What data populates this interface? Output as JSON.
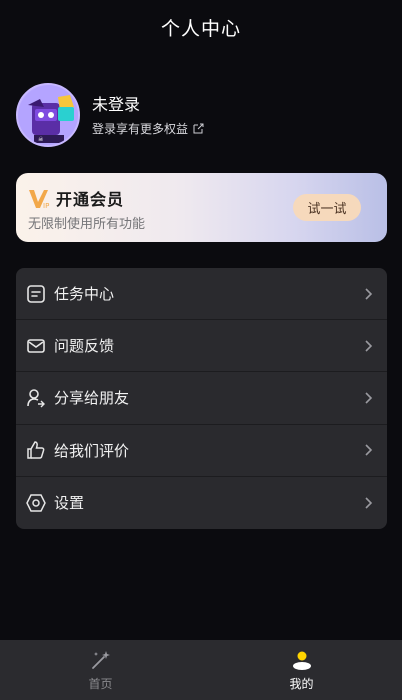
{
  "header": {
    "title": "个人中心"
  },
  "profile": {
    "name": "未登录",
    "subtitle": "登录享有更多权益"
  },
  "vip": {
    "title": "开通会员",
    "subtitle": "无限制使用所有功能",
    "button": "试一试",
    "logo_text": "VIP"
  },
  "menu": {
    "items": [
      {
        "label": "任务中心",
        "icon": "task-icon"
      },
      {
        "label": "问题反馈",
        "icon": "mail-icon"
      },
      {
        "label": "分享给朋友",
        "icon": "share-user-icon"
      },
      {
        "label": "给我们评价",
        "icon": "thumb-up-icon"
      },
      {
        "label": "设置",
        "icon": "settings-icon"
      }
    ]
  },
  "tabbar": {
    "tabs": [
      {
        "label": "首页",
        "icon": "magic-wand-icon",
        "active": false
      },
      {
        "label": "我的",
        "icon": "user-icon",
        "active": true
      }
    ]
  },
  "colors": {
    "background": "#0b0b0f",
    "card": "#2a2a2e",
    "vip_button": "#f6d9bc",
    "active_tab": "#ffd400"
  }
}
